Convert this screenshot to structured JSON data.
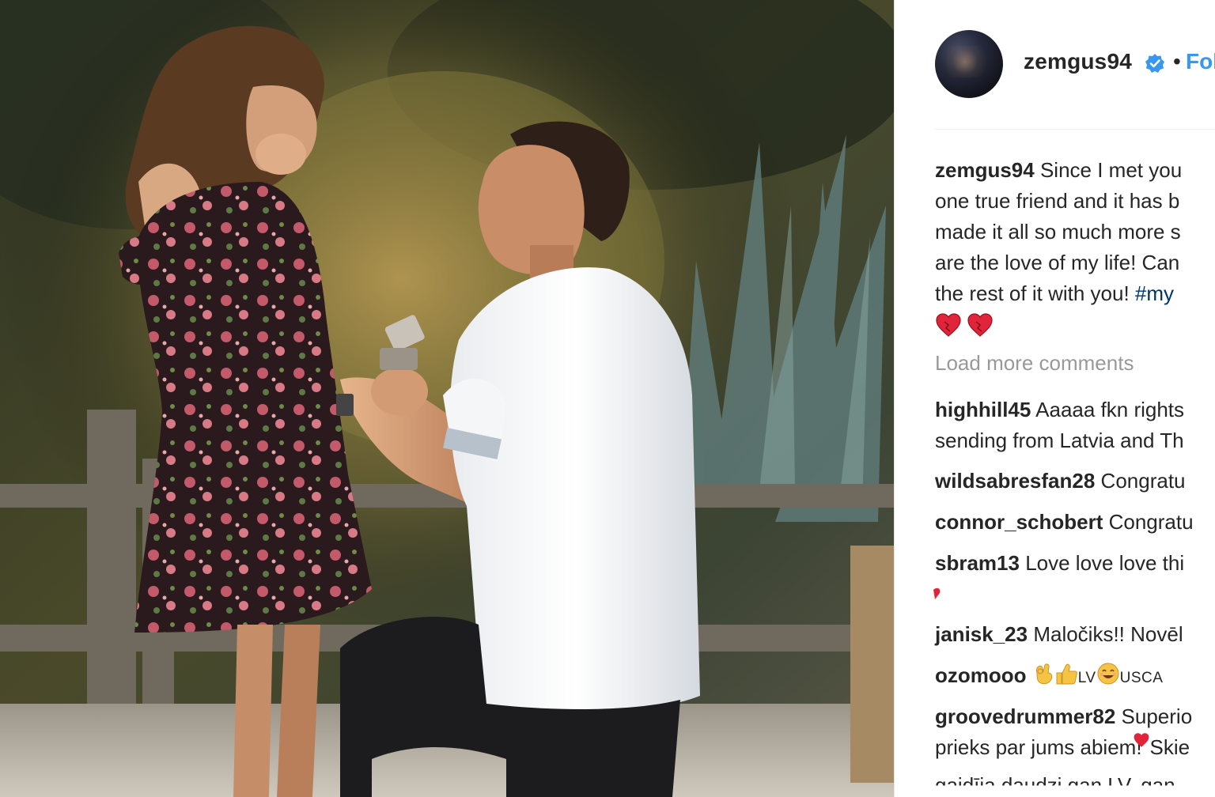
{
  "post": {
    "username": "zemgus94",
    "follow_label": "Follow",
    "separator": "•",
    "caption_lines": [
      "Since I met you",
      "one true friend and it has b",
      "made it all so much more s",
      "are the love of my life! Can",
      "the rest of it with you!"
    ],
    "caption_hashtag": "#my",
    "caption_hearts": [
      "heart-icon",
      "heart-icon"
    ]
  },
  "load_more_label": "Load more comments",
  "comments": [
    {
      "username": "highhill45",
      "text": "Aaaaa fkn rights",
      "continuation": "sending from Latvia and Th"
    },
    {
      "username": "wildsabresfan28",
      "text": "Congratu"
    },
    {
      "username": "connor_schobert",
      "text": "Congratu"
    },
    {
      "username": "sbram13",
      "text": "Love love love thi"
    },
    {
      "username": "janisk_23",
      "text": "Maločiks!! Novēl"
    },
    {
      "username": "ozomooo",
      "text_parts": [
        "LV",
        "USCA"
      ]
    },
    {
      "username": "groovedrummer82",
      "text": "Superio",
      "continuation": "prieks par jums abiem!",
      "continuation_tail": "Skie"
    }
  ],
  "cutoff_text": "gaidīja daudzi gan LV, gan",
  "colors": {
    "link": "#3897f0",
    "verified": "#3897f0",
    "text": "#262626",
    "muted": "#999999",
    "hashtag": "#003569"
  }
}
